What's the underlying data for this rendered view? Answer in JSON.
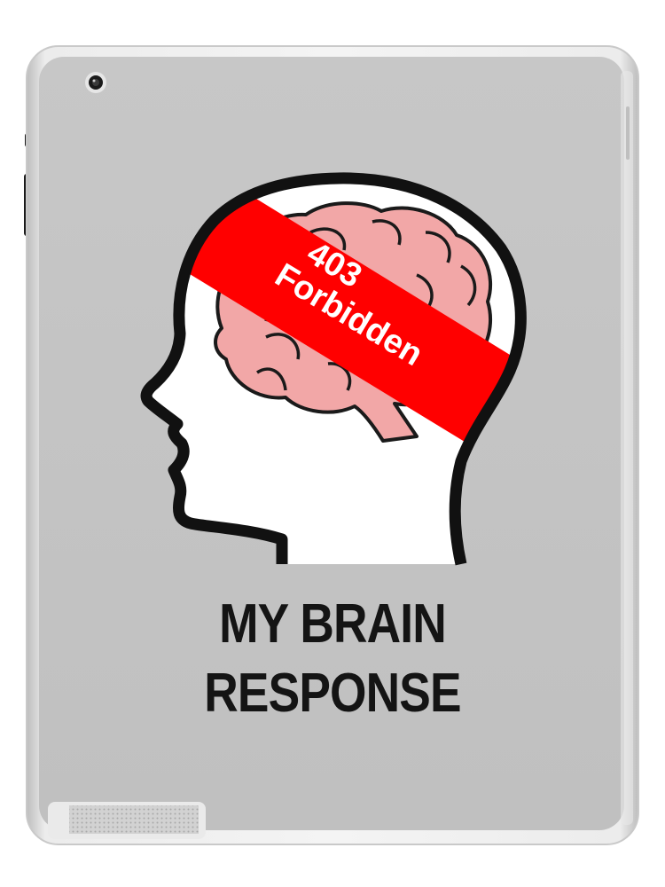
{
  "product": {
    "type": "tablet skin",
    "case_color": "#c3c3c3",
    "frame_color": "#e2e2e2"
  },
  "artwork": {
    "banner_text_line_1": "403",
    "banner_text_line_2": "Forbidden",
    "banner_color": "#ff0000",
    "brain_color": "#f2a7a7",
    "head_fill": "#ffffff",
    "outline_color": "#111111"
  },
  "caption": {
    "line_1": "MY BRAIN",
    "line_2": "RESPONSE"
  },
  "icons": [
    "camera-icon",
    "speaker-grille-icon",
    "home-connector-icon"
  ]
}
